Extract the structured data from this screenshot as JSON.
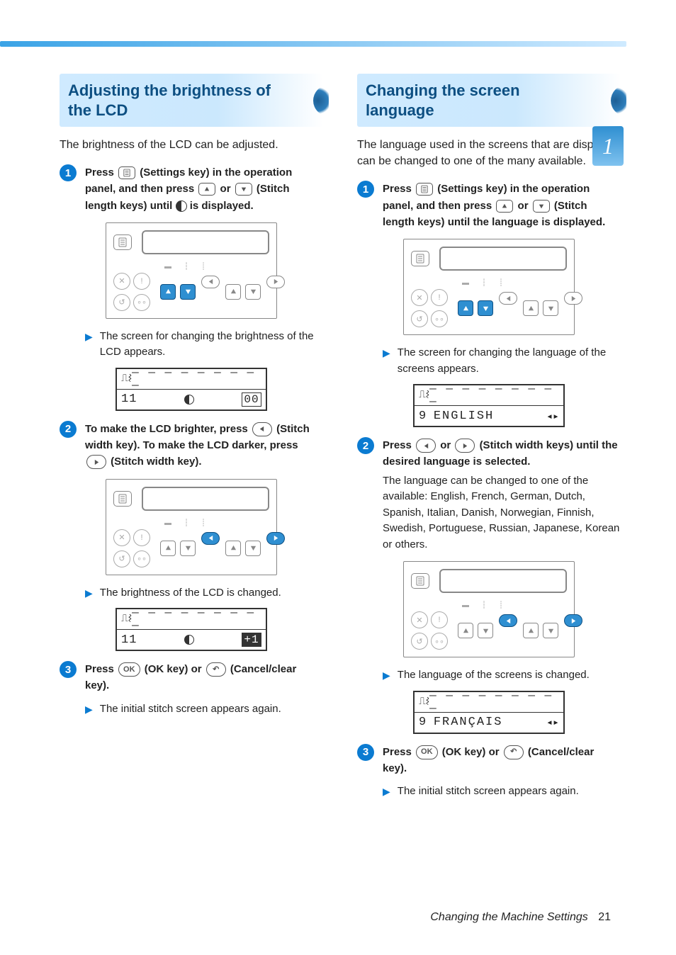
{
  "page": {
    "tab_number": "1",
    "footer_title": "Changing the Machine Settings",
    "footer_page": "21"
  },
  "left": {
    "heading": "Adjusting the brightness of the LCD",
    "intro": "The brightness of the LCD can be adjusted.",
    "step1": {
      "num": "1",
      "line1a": "Press ",
      "line1b": " (Settings key) in the operation panel, and then press ",
      "line1c": " or ",
      "line1d": " (Stitch length keys) until ",
      "line1e": " is displayed."
    },
    "step1_result": "The screen for changing the brightness of the LCD appears.",
    "lcd1": {
      "row1_dashes": "— — — — — — — — —",
      "row2_left": "11",
      "row2_right": "00"
    },
    "step2": {
      "num": "2",
      "line_a": "To make the LCD brighter, press ",
      "line_b": " (Stitch width key). To make the LCD darker, press ",
      "line_c": " (Stitch width key)."
    },
    "step2_result": "The brightness of the LCD is changed.",
    "lcd2": {
      "row1_dashes": "— — — — — — — — —",
      "row2_left": "11",
      "row2_right": "+1"
    },
    "step3": {
      "num": "3",
      "line_a": "Press ",
      "ok": "OK",
      "line_b": " (OK key) or ",
      "line_c": " (Cancel/clear key)."
    },
    "step3_result": "The initial stitch screen appears again."
  },
  "right": {
    "heading": "Changing the screen language",
    "intro": "The language used in the screens that are displayed can be changed to one of the many available.",
    "step1": {
      "num": "1",
      "line1a": "Press ",
      "line1b": " (Settings key) in the operation panel, and then press ",
      "line1c": " or ",
      "line1d": " (Stitch length keys) until the language is displayed."
    },
    "step1_result": "The screen for changing the language of the screens appears.",
    "lcd1": {
      "row1_dashes": "— — — — — — — — —",
      "row2_left": "9",
      "row2_text": "ENGLISH"
    },
    "step2": {
      "num": "2",
      "line_a": "Press ",
      "line_b": " or ",
      "line_c": " (Stitch width keys) until the desired language is selected.",
      "note": "The language can be changed to one of the available: English, French, German, Dutch, Spanish, Italian, Danish, Norwegian, Finnish, Swedish, Portuguese, Russian, Japanese, Korean or others."
    },
    "step2_result": "The language of the screens is changed.",
    "lcd2": {
      "row1_dashes": "— — — — — — — — —",
      "row2_left": "9",
      "row2_text": "FRANÇAIS"
    },
    "step3": {
      "num": "3",
      "line_a": "Press ",
      "ok": "OK",
      "line_b": " (OK key) or ",
      "line_c": " (Cancel/clear key)."
    },
    "step3_result": "The initial stitch screen appears again."
  }
}
